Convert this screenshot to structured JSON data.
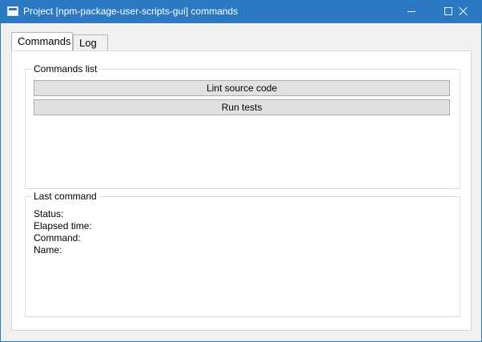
{
  "window": {
    "title": "Project [npm-package-user-scripts-gui] commands"
  },
  "tabs": [
    {
      "label": "Commands",
      "active": true
    },
    {
      "label": "Log",
      "active": false
    }
  ],
  "commands_list": {
    "legend": "Commands list",
    "buttons": [
      {
        "label": "Lint source code"
      },
      {
        "label": "Run tests"
      }
    ]
  },
  "last_command": {
    "legend": "Last command",
    "fields": [
      {
        "label": "Status:"
      },
      {
        "label": "Elapsed time:"
      },
      {
        "label": "Command:"
      },
      {
        "label": "Name:"
      }
    ]
  }
}
